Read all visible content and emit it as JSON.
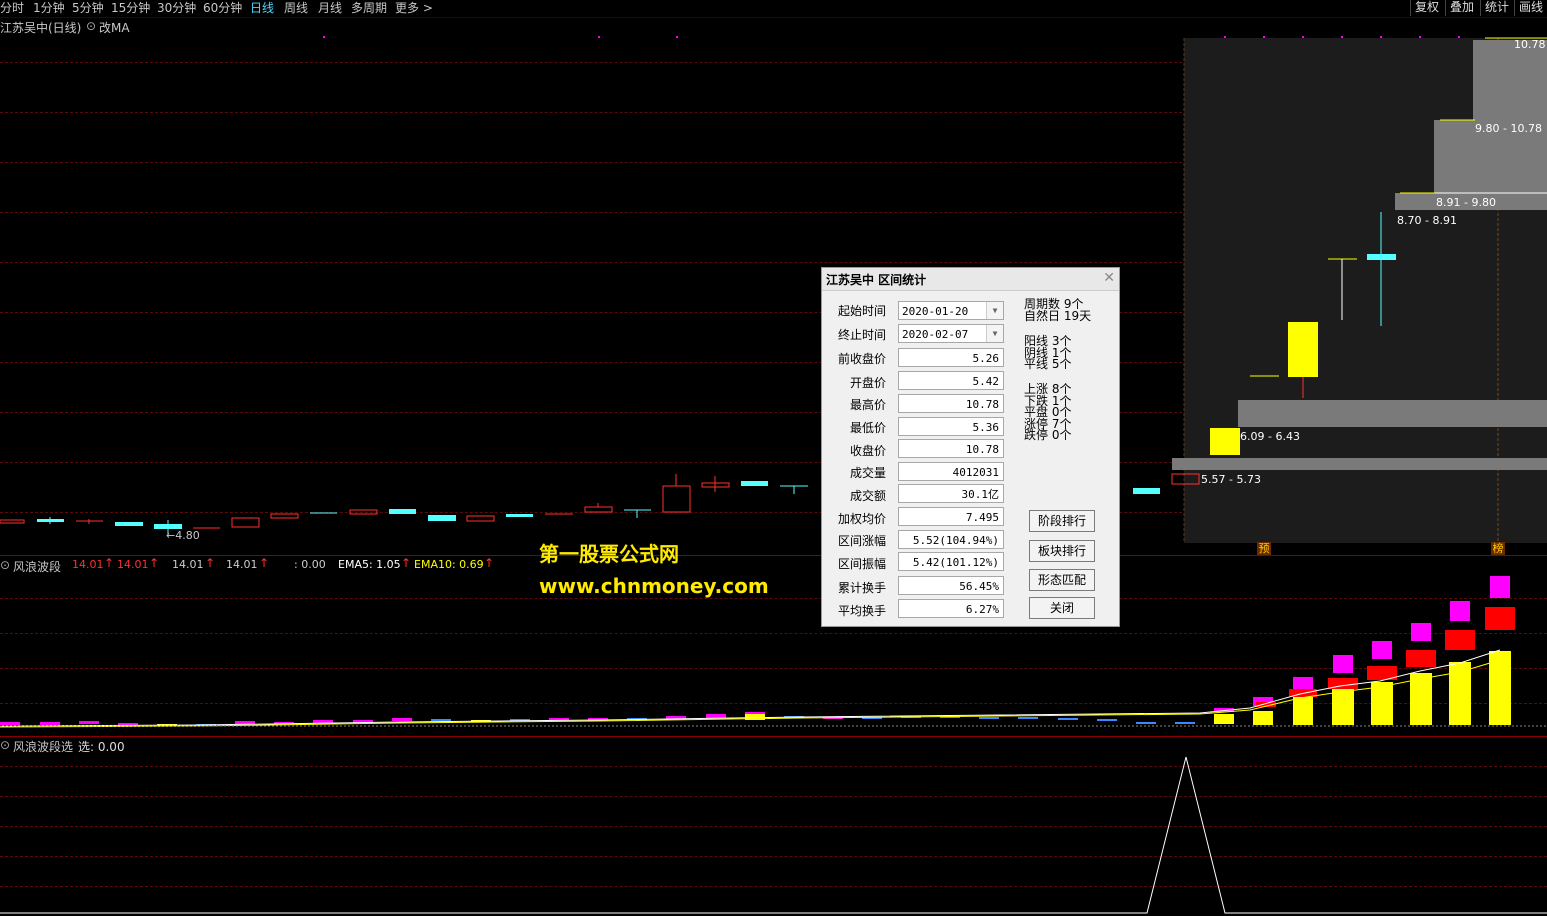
{
  "toolbar": {
    "periods": [
      "分时",
      "1分钟",
      "5分钟",
      "15分钟",
      "30分钟",
      "60分钟",
      "日线",
      "周线",
      "月线",
      "多周期",
      "更多 >"
    ],
    "active": "日线",
    "right_buttons": [
      "复权",
      "叠加",
      "统计",
      "画线"
    ]
  },
  "main_chart": {
    "title": "江苏吴中(日线)",
    "ma_toggle": "改MA",
    "low_marker": "←4.80",
    "price_ranges": [
      "10.78",
      "9.80 - 10.78",
      "8.91 - 9.80",
      "8.70 - 8.91",
      "6.09 - 6.43",
      "5.57 - 5.73"
    ],
    "tag_yu": "预",
    "tag_bang": "榜"
  },
  "indicator1": {
    "name": "风浪波段",
    "values": [
      "14.01",
      "14.01",
      "14.01",
      "14.01"
    ],
    "value5": ": 0.00",
    "ema5_label": "EMA5: 1.05",
    "ema10_label": "EMA10: 0.69"
  },
  "indicator2": {
    "name": "风浪波段选",
    "value": "选: 0.00"
  },
  "watermark": {
    "line1": "第一股票公式网",
    "line2": "www.chnmoney.com"
  },
  "dialog": {
    "title": "江苏吴中 区间统计",
    "fields": [
      {
        "label": "起始时间",
        "value": "2020-01-20"
      },
      {
        "label": "终止时间",
        "value": "2020-02-07"
      },
      {
        "label": "前收盘价",
        "value": "5.26"
      },
      {
        "label": "开盘价",
        "value": "5.42"
      },
      {
        "label": "最高价",
        "value": "10.78"
      },
      {
        "label": "最低价",
        "value": "5.36"
      },
      {
        "label": "收盘价",
        "value": "10.78"
      },
      {
        "label": "成交量",
        "value": "4012031"
      },
      {
        "label": "成交额",
        "value": "30.1亿"
      },
      {
        "label": "加权均价",
        "value": "7.495"
      },
      {
        "label": "区间涨幅",
        "value": "5.52(104.94%)"
      },
      {
        "label": "区间振幅",
        "value": "5.42(101.12%)"
      },
      {
        "label": "累计换手",
        "value": "56.45%"
      },
      {
        "label": "平均换手",
        "value": "6.27%"
      }
    ],
    "stats": {
      "cycles": "周期数 9个",
      "natural_days": "自然日 19天",
      "yang": "阳线 3个",
      "yin": "阴线 1个",
      "flat": "平线 5个",
      "up": "上涨 8个",
      "down": "下跌 1个",
      "even": "平盘 0个",
      "limit_up": "涨停 7个",
      "limit_down": "跌停 0个"
    },
    "buttons": [
      "阶段排行",
      "板块排行",
      "形态匹配",
      "关闭"
    ]
  },
  "colors": {
    "up": "#ff3030",
    "down": "#54ffff",
    "yellow": "#ffff00",
    "magenta": "#ff00ff",
    "grid": "#5a0a0a",
    "sep": "#8a0000"
  }
}
